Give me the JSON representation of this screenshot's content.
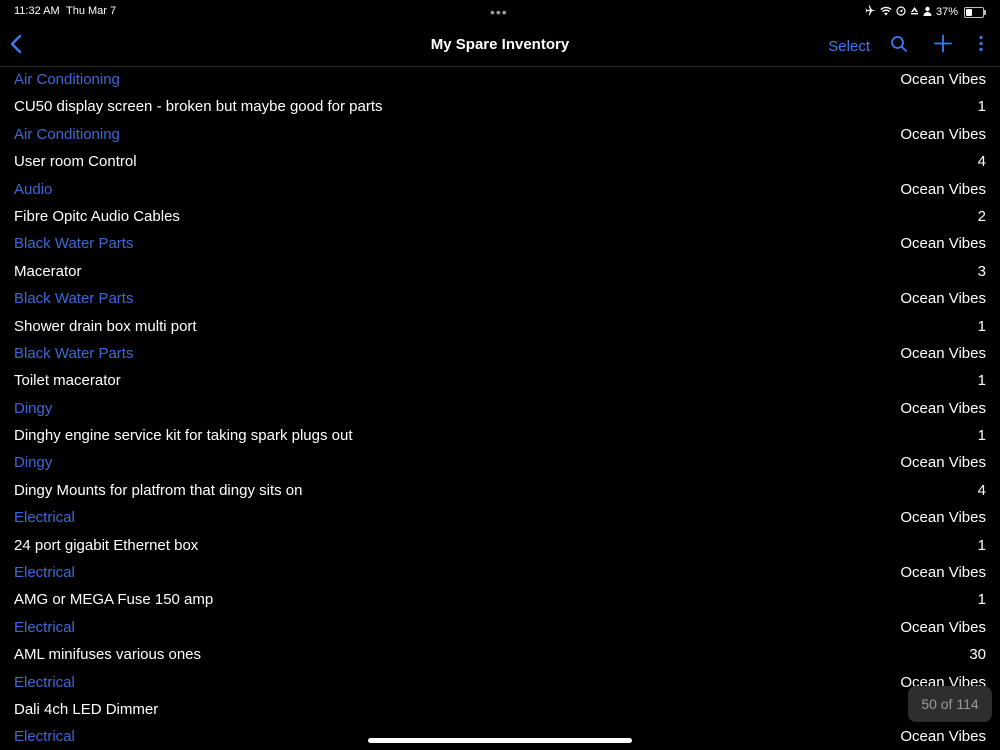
{
  "status_bar": {
    "time": "11:32 AM",
    "date": "Thu Mar 7",
    "multitask": "•••",
    "battery_percent": "37%",
    "battery_level": 0.37,
    "icons": [
      "airplane-icon",
      "wifi-icon",
      "location-icon",
      "alarm-icon",
      "person-icon",
      "battery-icon"
    ]
  },
  "nav": {
    "title": "My Spare Inventory",
    "select_label": "Select",
    "back_icon": "chevron-left-icon",
    "search_icon": "search-icon",
    "add_icon": "plus-icon",
    "more_icon": "more-vertical-icon"
  },
  "colors": {
    "accent": "#3a7bf2",
    "category_text": "#3d68d8",
    "background": "#000000"
  },
  "rows": [
    {
      "kind": "category",
      "label": "Air Conditioning",
      "value": "Ocean Vibes"
    },
    {
      "kind": "item",
      "label": "CU50 display screen - broken but maybe good for parts",
      "value": "1"
    },
    {
      "kind": "category",
      "label": "Air Conditioning",
      "value": "Ocean Vibes"
    },
    {
      "kind": "item",
      "label": "User room Control",
      "value": "4"
    },
    {
      "kind": "category",
      "label": "Audio",
      "value": "Ocean Vibes"
    },
    {
      "kind": "item",
      "label": "Fibre Opitc Audio Cables",
      "value": "2"
    },
    {
      "kind": "category",
      "label": "Black Water Parts",
      "value": "Ocean Vibes"
    },
    {
      "kind": "item",
      "label": "Macerator",
      "value": "3"
    },
    {
      "kind": "category",
      "label": "Black Water Parts",
      "value": "Ocean Vibes"
    },
    {
      "kind": "item",
      "label": "Shower drain box multi port",
      "value": "1"
    },
    {
      "kind": "category",
      "label": "Black Water Parts",
      "value": "Ocean Vibes"
    },
    {
      "kind": "item",
      "label": "Toilet macerator",
      "value": "1"
    },
    {
      "kind": "category",
      "label": "Dingy",
      "value": "Ocean Vibes"
    },
    {
      "kind": "item",
      "label": "Dinghy engine service kit for taking spark plugs out",
      "value": "1"
    },
    {
      "kind": "category",
      "label": "Dingy",
      "value": "Ocean Vibes"
    },
    {
      "kind": "item",
      "label": "Dingy Mounts for platfrom that dingy sits on",
      "value": "4"
    },
    {
      "kind": "category",
      "label": "Electrical",
      "value": "Ocean Vibes"
    },
    {
      "kind": "item",
      "label": "24 port gigabit Ethernet box",
      "value": "1"
    },
    {
      "kind": "category",
      "label": "Electrical",
      "value": "Ocean Vibes"
    },
    {
      "kind": "item",
      "label": "AMG or MEGA Fuse 150 amp",
      "value": "1"
    },
    {
      "kind": "category",
      "label": "Electrical",
      "value": "Ocean Vibes"
    },
    {
      "kind": "item",
      "label": "AML minifuses various ones",
      "value": "30"
    },
    {
      "kind": "category",
      "label": "Electrical",
      "value": "Ocean Vibes"
    },
    {
      "kind": "item",
      "label": "Dali 4ch LED Dimmer",
      "value": ""
    },
    {
      "kind": "category",
      "label": "Electrical",
      "value": "Ocean Vibes"
    }
  ],
  "page_counter": {
    "text": "50 of  114"
  }
}
